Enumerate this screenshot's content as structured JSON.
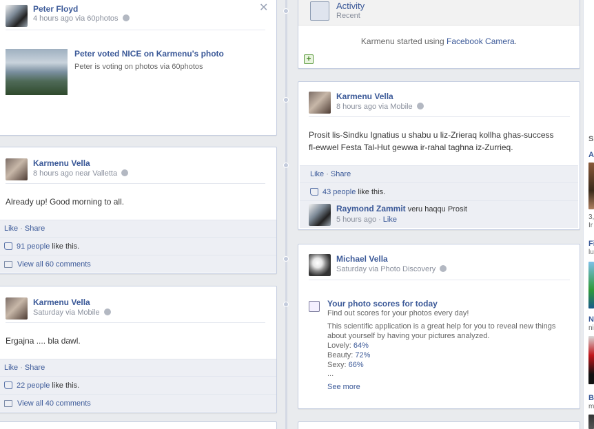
{
  "left": {
    "card1": {
      "author": "Peter Floyd",
      "meta": "4 hours ago via 60photos",
      "story_title": "Peter voted NICE on Karmenu's photo",
      "story_sub": "Peter is voting on photos via 60photos"
    },
    "card2": {
      "author": "Karmenu Vella",
      "meta": "8 hours ago near Valletta",
      "text": "Already up! Good morning to all.",
      "like": "Like",
      "share": "Share",
      "likes_count": "91 people",
      "likes_suffix": " like this.",
      "view_comments": "View all 60 comments"
    },
    "card3": {
      "author": "Karmenu Vella",
      "meta": "Saturday via Mobile",
      "text": "Ergajna .... bla dawl.",
      "like": "Like",
      "share": "Share",
      "likes_count": "22 people",
      "likes_suffix": " like this.",
      "view_comments": "View all 40 comments"
    }
  },
  "right": {
    "activity": {
      "title": "Activity",
      "sub": "Recent",
      "story_prefix": "Karmenu started using ",
      "story_link": "Facebook Camera",
      "story_suffix": "."
    },
    "card2": {
      "author": "Karmenu Vella",
      "meta": "8 hours ago via Mobile",
      "text_line1": "Prosit lis-Sindku Ignatius u shabu u liz-Zrieraq kollha ghas-success",
      "text_line2": "fl-ewwel Festa Tal-Hut gewwa ir-rahal taghna iz-Zurrieq.",
      "like": "Like",
      "share": "Share",
      "likes_count": "43 people",
      "likes_suffix": " like this.",
      "commenter": "Raymond Zammit",
      "comment_text": " veru haqqu Prosit",
      "comment_time": "5 hours ago",
      "comment_like": "Like"
    },
    "card3": {
      "author": "Michael Vella",
      "meta": "Saturday via Photo Discovery",
      "app_title": "Your photo scores for today",
      "app_sub": "Find out scores for your photos every day!",
      "desc_line1": "This scientific application is a great help for you to reveal new things",
      "desc_line2": "about yourself by having your pictures analyzed.",
      "score_lovely_label": "Lovely: ",
      "score_lovely": "64%",
      "score_beauty_label": "Beauty: ",
      "score_beauty": "72%",
      "score_sexy_label": "Sexy: ",
      "score_sexy": "66%",
      "ellipsis": "...",
      "see_more": "See more"
    }
  },
  "edge": {
    "t1": "S",
    "t2": "A",
    "t3": "3,",
    "t4": "Ir",
    "t5": "Fi",
    "t6": "lu",
    "t7": "N",
    "t8": "ni",
    "t9": "B",
    "t10": "m"
  },
  "colors": {
    "link": "#3b5998",
    "ufi_bg": "#edeff4",
    "page_bg": "#e9ebee"
  }
}
